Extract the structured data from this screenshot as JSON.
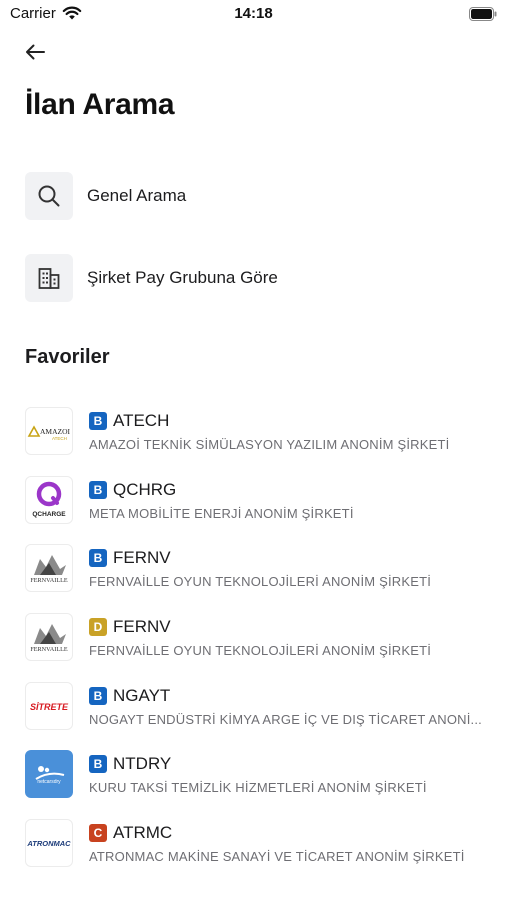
{
  "status_bar": {
    "carrier": "Carrier",
    "time": "14:18"
  },
  "header": {
    "title": "İlan Arama"
  },
  "options": [
    {
      "label": "Genel Arama",
      "icon": "search-icon"
    },
    {
      "label": "Şirket Pay Grubuna Göre",
      "icon": "building-icon"
    }
  ],
  "favorites": {
    "title": "Favoriler",
    "items": [
      {
        "badge": "B",
        "badge_color": "#1565c0",
        "code": "ATECH",
        "company": "AMAZOİ TEKNİK SİMÜLASYON YAZILIM ANONİM ŞİRKETİ",
        "logo": "amazoi-logo",
        "logo_text": "AMAZOI",
        "logo_subtext": "ATECH"
      },
      {
        "badge": "B",
        "badge_color": "#1565c0",
        "code": "QCHRG",
        "company": "META MOBİLİTE ENERJİ ANONİM ŞİRKETİ",
        "logo": "qcharge-logo",
        "logo_text": "QCHARGE"
      },
      {
        "badge": "B",
        "badge_color": "#1565c0",
        "code": "FERNV",
        "company": "FERNVAİLLE OYUN TEKNOLOJİLERİ ANONİM ŞİRKETİ",
        "logo": "fernvaille-logo",
        "logo_text": "FERNVAILLE"
      },
      {
        "badge": "D",
        "badge_color": "#c9a227",
        "code": "FERNV",
        "company": "FERNVAİLLE OYUN TEKNOLOJİLERİ ANONİM ŞİRKETİ",
        "logo": "fernvaille-logo",
        "logo_text": "FERNVAILLE"
      },
      {
        "badge": "B",
        "badge_color": "#1565c0",
        "code": "NGAYT",
        "company": "NOGAYT ENDÜSTRİ KİMYA ARGE İÇ VE DIŞ TİCARET ANONİ...",
        "logo": "sitrete-logo",
        "logo_text": "SİTRETE"
      },
      {
        "badge": "B",
        "badge_color": "#1565c0",
        "code": "NTDRY",
        "company": "KURU TAKSİ TEMİZLİK HİZMETLERİ ANONİM ŞİRKETİ",
        "logo": "netdry-logo",
        "logo_text": "netcarsdry"
      },
      {
        "badge": "C",
        "badge_color": "#c8421f",
        "code": "ATRMC",
        "company": "ATRONMAC MAKİNE SANAYİ VE TİCARET ANONİM ŞİRKETİ",
        "logo": "atronmac-logo",
        "logo_text": "ATRONMAC"
      }
    ]
  },
  "colors": {
    "badge_b": "#1565c0",
    "badge_d": "#c9a227",
    "badge_c": "#c8421f",
    "icon_box": "#f1f2f4"
  }
}
